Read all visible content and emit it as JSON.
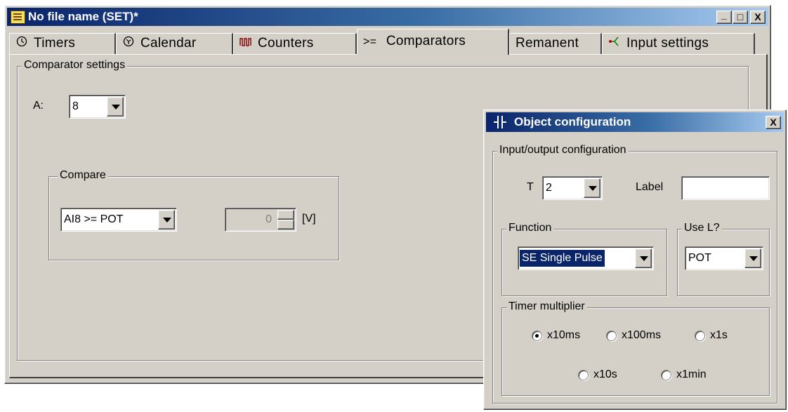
{
  "main_window": {
    "title": "No file name (SET)*",
    "controls": {
      "minimize": "_",
      "maximize": "□",
      "close": "X"
    }
  },
  "tabs": [
    {
      "label": "Timers",
      "icon": "clock-icon"
    },
    {
      "label": "Calendar",
      "icon": "calendar-clock-icon"
    },
    {
      "label": "Counters",
      "icon": "pulse-counter-icon"
    },
    {
      "label": "Comparators",
      "icon": ">="
    },
    {
      "label": "Remanent",
      "icon": ""
    },
    {
      "label": "Input settings",
      "icon": "input-settings-icon"
    }
  ],
  "active_tab": "Comparators",
  "comparator_settings": {
    "legend": "Comparator settings",
    "a_label": "A:",
    "a_value": "8",
    "compare": {
      "legend": "Compare",
      "expression": "AI8 >= POT",
      "spinner_value": "0",
      "unit": "[V]"
    }
  },
  "dialog": {
    "title": "Object configuration",
    "close": "X",
    "io_config": {
      "legend": "Input/output configuration",
      "t_label": "T",
      "t_value": "2",
      "label_label": "Label",
      "label_value": ""
    },
    "function": {
      "legend": "Function",
      "value": "SE Single Pulse"
    },
    "use_l": {
      "legend": "Use L?",
      "value": "POT"
    },
    "timer_multiplier": {
      "legend": "Timer multiplier",
      "options": [
        "x10ms",
        "x100ms",
        "x1s",
        "x10s",
        "x1min"
      ],
      "selected": "x10ms"
    }
  }
}
